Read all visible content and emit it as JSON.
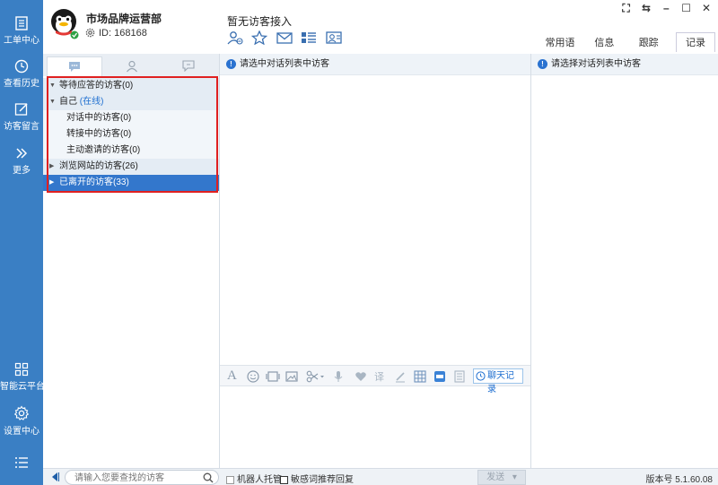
{
  "nav": {
    "items": [
      {
        "label": "工单中心",
        "icon": "document-icon"
      },
      {
        "label": "查看历史",
        "icon": "clock-icon"
      },
      {
        "label": "访客留言",
        "icon": "edit-icon"
      },
      {
        "label": "更多",
        "icon": "double-chevron-right-icon"
      },
      {
        "label": "智能云平台",
        "icon": "grid-icon"
      },
      {
        "label": "设置中心",
        "icon": "gear-icon"
      }
    ]
  },
  "header": {
    "company": "市场品牌运营部",
    "user_id": "ID: 168168",
    "status": "暂无访客接入",
    "right_tabs": [
      "常用语",
      "信息",
      "跟踪",
      "记录"
    ],
    "window_controls": [
      "⛶",
      "⇆",
      "–",
      "☐",
      "✕"
    ]
  },
  "visitor_list": {
    "groups": [
      {
        "label": "等待应答的访客(0)"
      },
      {
        "label": "自己",
        "online_label": "(在线)"
      },
      {
        "label": "对话中的访客(0)"
      },
      {
        "label": "转接中的访客(0)"
      },
      {
        "label": "主动邀请的访客(0)"
      },
      {
        "label": "浏览网站的访客(26)"
      },
      {
        "label": "已离开的访客(33)"
      }
    ]
  },
  "chat": {
    "notice": "请选中对话列表中访客",
    "history_button": "聊天记录"
  },
  "right_panel": {
    "notice": "请选择对话列表中访客"
  },
  "bottom": {
    "search_placeholder": "请输入您要查找的访客",
    "robot_label": "机器人托管",
    "sensitive_label": "敏感词推荐回复",
    "send_label": "发送",
    "version": "版本号 5.1.60.08"
  },
  "colors": {
    "nav_bg": "#3a7fc4",
    "selected_row": "#3377cc",
    "highlight_border": "#e02020",
    "online_text": "#1f6fd0"
  }
}
